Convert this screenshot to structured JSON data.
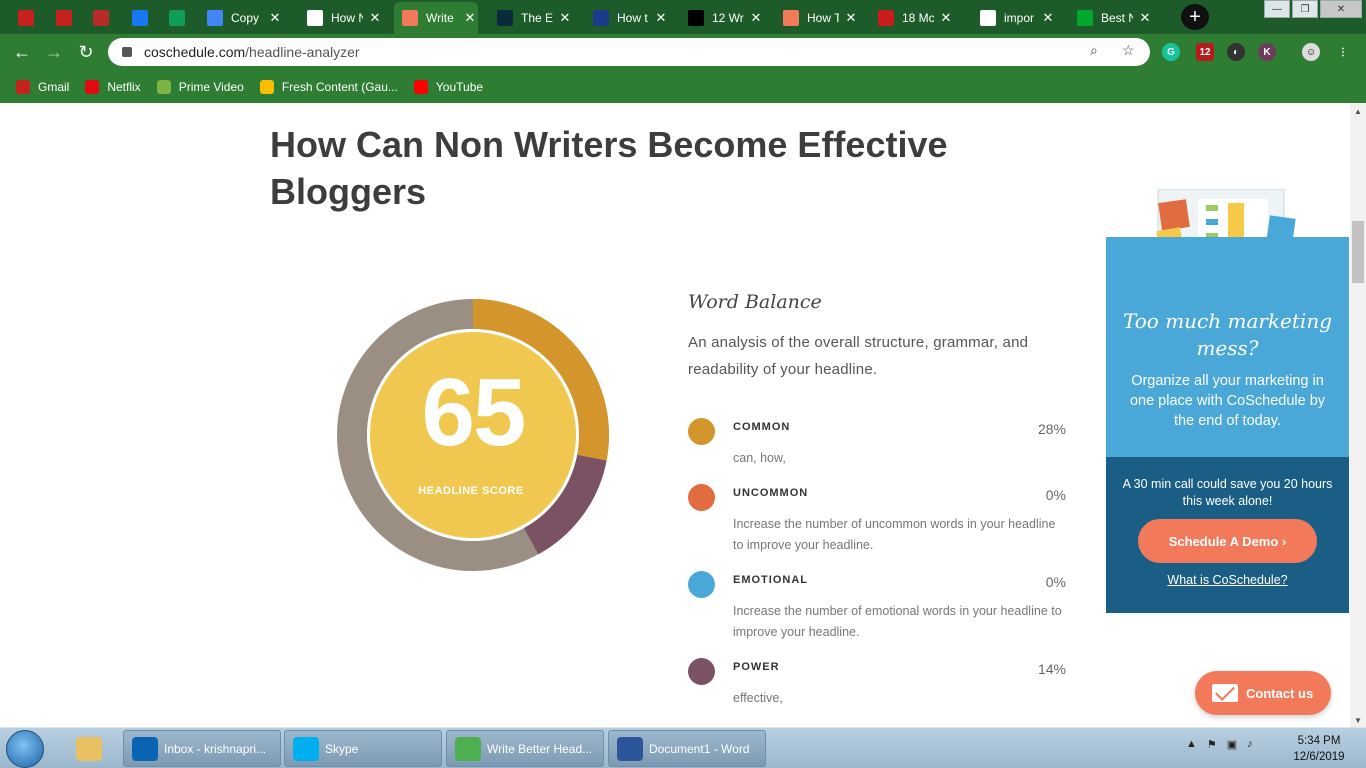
{
  "browser": {
    "tabs": [
      {
        "title": "",
        "icon": "gmail-icon",
        "color": "#c5221f"
      },
      {
        "title": "",
        "icon": "gmail-icon",
        "color": "#c5221f"
      },
      {
        "title": "",
        "icon": "quora-icon",
        "color": "#b92b27"
      },
      {
        "title": "",
        "icon": "facebook-icon",
        "color": "#1877f2"
      },
      {
        "title": "",
        "icon": "sheets-icon",
        "color": "#0f9d58"
      },
      {
        "title": "Copy c",
        "icon": "docs-icon",
        "color": "#4285f4"
      },
      {
        "title": "How N",
        "icon": "google-icon",
        "color": "#ffffff"
      },
      {
        "title": "Write",
        "icon": "coschedule-icon",
        "color": "#f27a5a"
      },
      {
        "title": "The Es",
        "icon": "site-icon",
        "color": "#0b2b3a"
      },
      {
        "title": "How t",
        "icon": "medium-icon",
        "color": "#1a3b8a"
      },
      {
        "title": "12 Wr",
        "icon": "dl-icon",
        "color": "#000000"
      },
      {
        "title": "How T",
        "icon": "coschedule-icon",
        "color": "#f27a5a"
      },
      {
        "title": "18 Mc",
        "icon": "site-icon",
        "color": "#c81e1e"
      },
      {
        "title": "impor",
        "icon": "google-icon",
        "color": "#ffffff"
      },
      {
        "title": "Best N",
        "icon": "evernote-icon",
        "color": "#00a82d"
      }
    ],
    "url_host": "coschedule.com",
    "url_path": "/headline-analyzer",
    "bookmarks": [
      {
        "label": "Gmail",
        "color": "#c5221f"
      },
      {
        "label": "Netflix",
        "color": "#e50914"
      },
      {
        "label": "Prime Video",
        "color": "#7cb342"
      },
      {
        "label": "Fresh Content (Gau...",
        "color": "#fbbc04"
      },
      {
        "label": "YouTube",
        "color": "#ff0000"
      }
    ],
    "ext_badge": "12"
  },
  "page": {
    "headline": "How Can Non Writers Become Effective Bloggers",
    "score": "65",
    "score_label": "HEADLINE SCORE",
    "score_percent_ring": {
      "common": 28,
      "power": 14,
      "colors": {
        "common": "#d4962c",
        "power": "#7a5264",
        "rest": "#9b8f84",
        "inner": "#f0c84f"
      }
    },
    "word_balance": {
      "title": "Word Balance",
      "description": "An analysis of the overall structure, grammar, and readability of your headline.",
      "rows": [
        {
          "label": "COMMON",
          "pct": "28%",
          "desc": "can, how,",
          "color": "#d4962c"
        },
        {
          "label": "UNCOMMON",
          "pct": "0%",
          "desc": "Increase the number of uncommon words in your headline to improve your headline.",
          "color": "#e06c40"
        },
        {
          "label": "EMOTIONAL",
          "pct": "0%",
          "desc": "Increase the number of emotional words in your headline to improve your headline.",
          "color": "#4aa8d8"
        },
        {
          "label": "POWER",
          "pct": "14%",
          "desc": "effective,",
          "color": "#7a5264"
        }
      ]
    },
    "ad": {
      "heading": "Too much marketing mess?",
      "text": "Organize all your marketing in one place with CoSchedule by the end of today.",
      "call": "A 30 min call could save you 20 hours this week alone!",
      "button": "Schedule A Demo ›",
      "link": "What is CoSchedule?"
    },
    "contact": "Contact us"
  },
  "taskbar": {
    "items": [
      {
        "label": "Inbox - krishnapri...",
        "icon": "outlook-icon",
        "color": "#0a64b4"
      },
      {
        "label": "Skype",
        "icon": "skype-icon",
        "color": "#00aff0"
      },
      {
        "label": "Write Better Head...",
        "icon": "chrome-icon",
        "color": "#4caf50"
      },
      {
        "label": "Document1 - Word",
        "icon": "word-icon",
        "color": "#2b579a"
      }
    ],
    "time": "5:34 PM",
    "date": "12/6/2019"
  }
}
